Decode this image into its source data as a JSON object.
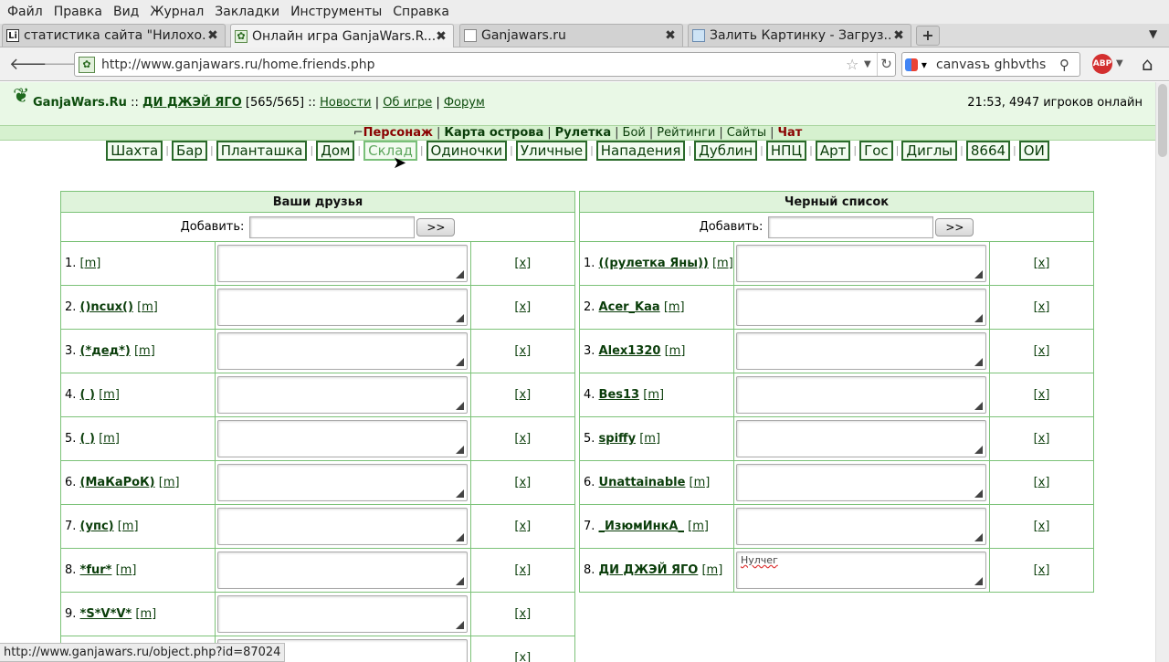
{
  "menubar": [
    "Файл",
    "Правка",
    "Вид",
    "Журнал",
    "Закладки",
    "Инструменты",
    "Справка"
  ],
  "tabs": [
    {
      "title": "статистика сайта \"Нилохо...",
      "icon": "Li",
      "active": false
    },
    {
      "title": "Онлайн игра GanjaWars.R...",
      "icon": "leaf",
      "active": true
    },
    {
      "title": "Ganjawars.ru",
      "icon": "page",
      "active": false
    },
    {
      "title": "Залить Картинку - Загруз...",
      "icon": "image",
      "active": false
    }
  ],
  "nav": {
    "url": "http://www.ganjawars.ru/home.friends.php",
    "search": "canvasъ ghbvths",
    "abp": "ABP"
  },
  "site": {
    "name": "GanjaWars.Ru",
    "sep": "::",
    "player": "ДИ ДЖЭЙ ЯГО",
    "hp": "[565/565]",
    "links": [
      "Новости",
      "Об игре",
      "Форум"
    ],
    "online": "21:53, 4947 игроков онлайн"
  },
  "mainmenu": {
    "pers": "Персонаж",
    "map": "Карта острова",
    "roulette": "Рулетка",
    "fight": "Бой",
    "ratings": "Рейтинги",
    "sites": "Сайты",
    "chat": "Чат"
  },
  "sublinks": [
    "Шахта",
    "Бар",
    "Планташка",
    "Дом",
    "Склад",
    "Одиночки",
    "Уличные",
    "Нападения",
    "Дублин",
    "НПЦ",
    "Арт",
    "Гос",
    "Диглы",
    "8664",
    "ОИ"
  ],
  "friends": {
    "title": "Ваши друзья",
    "add_label": "Добавить:",
    "add_btn": ">>",
    "rows": [
      {
        "num": "1.",
        "nick": "",
        "m": "[m]",
        "note": "",
        "del": "[x]"
      },
      {
        "num": "2.",
        "nick": "()ncux()",
        "m": "[m]",
        "note": "",
        "del": "[x]"
      },
      {
        "num": "3.",
        "nick": "(*дед*)",
        "m": "[m]",
        "note": "",
        "del": "[x]"
      },
      {
        "num": "4.",
        "nick": "( )",
        "m": "[m]",
        "note": "",
        "del": "[x]"
      },
      {
        "num": "5.",
        "nick": "(   )",
        "m": "[m]",
        "note": "",
        "del": "[x]"
      },
      {
        "num": "6.",
        "nick": "(МаКаРоК)",
        "m": "[m]",
        "note": "",
        "del": "[x]"
      },
      {
        "num": "7.",
        "nick": "(упс)",
        "m": "[m]",
        "note": "",
        "del": "[x]"
      },
      {
        "num": "8.",
        "nick": "*fur*",
        "m": "[m]",
        "note": "",
        "del": "[x]"
      },
      {
        "num": "9.",
        "nick": "*S*V*V*",
        "m": "[m]",
        "note": "",
        "del": "[x]"
      },
      {
        "num": "",
        "nick": "",
        "m": "",
        "note": "",
        "del": "[x]"
      }
    ]
  },
  "blacklist": {
    "title": "Черный список",
    "add_label": "Добавить:",
    "add_btn": ">>",
    "rows": [
      {
        "num": "1.",
        "nick": "((рулетка Яны))",
        "m": "[m]",
        "note": "",
        "del": "[x]"
      },
      {
        "num": "2.",
        "nick": "Acer_Kaa",
        "m": "[m]",
        "note": "",
        "del": "[x]"
      },
      {
        "num": "3.",
        "nick": "Alex1320",
        "m": "[m]",
        "note": "",
        "del": "[x]"
      },
      {
        "num": "4.",
        "nick": "Bes13",
        "m": "[m]",
        "note": "",
        "del": "[x]"
      },
      {
        "num": "5.",
        "nick": "spiffy",
        "m": "[m]",
        "note": "",
        "del": "[x]"
      },
      {
        "num": "6.",
        "nick": "Unattainable",
        "m": "[m]",
        "note": "",
        "del": "[x]"
      },
      {
        "num": "7.",
        "nick": "_ИзюмИнкА_",
        "m": "[m]",
        "note": "",
        "del": "[x]"
      },
      {
        "num": "8.",
        "nick": "ДИ ДЖЭЙ ЯГО",
        "m": "[m]",
        "note": "Нулчег",
        "del": "[x]"
      }
    ]
  },
  "status": "http://www.ganjawars.ru/object.php?id=87024"
}
